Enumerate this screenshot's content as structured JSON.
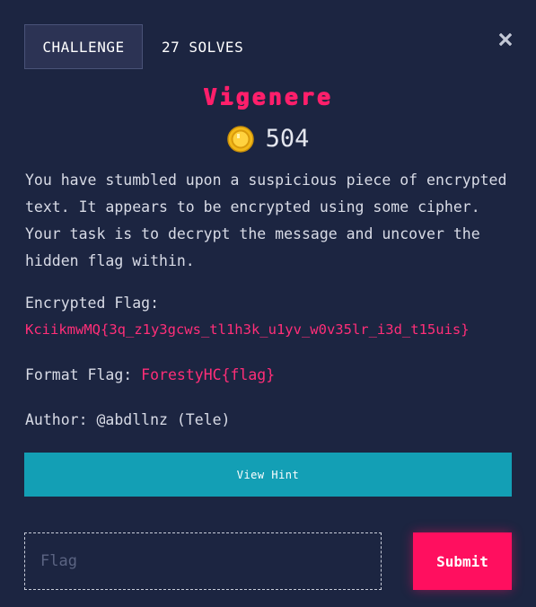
{
  "tabs": {
    "challenge_label": "CHALLENGE",
    "solves_label": "27 SOLVES"
  },
  "challenge": {
    "title": "Vigenere",
    "points": "504",
    "description": "You have stumbled upon a suspicious piece of encrypted text. It appears to be encrypted using some cipher. Your task is to decrypt the message and uncover the hidden flag within.",
    "encrypted_label": "Encrypted Flag:",
    "encrypted_value": "KciikmwMQ{3q_z1y3gcws_tl1h3k_u1yv_w0v35lr_i3d_t15uis}",
    "format_label": "Format Flag:",
    "format_value": "ForestyHC{flag}",
    "author": "Author: @abdllnz (Tele)"
  },
  "actions": {
    "hint_label": "View Hint",
    "flag_placeholder": "Flag",
    "submit_label": "Submit"
  },
  "colors": {
    "background": "#1c2541",
    "accent_pink": "#ff1f6b",
    "hint_teal": "#139fb5",
    "submit_pink": "#ff0f5f"
  },
  "icons": {
    "close": "close-icon",
    "coin": "coin-icon"
  }
}
